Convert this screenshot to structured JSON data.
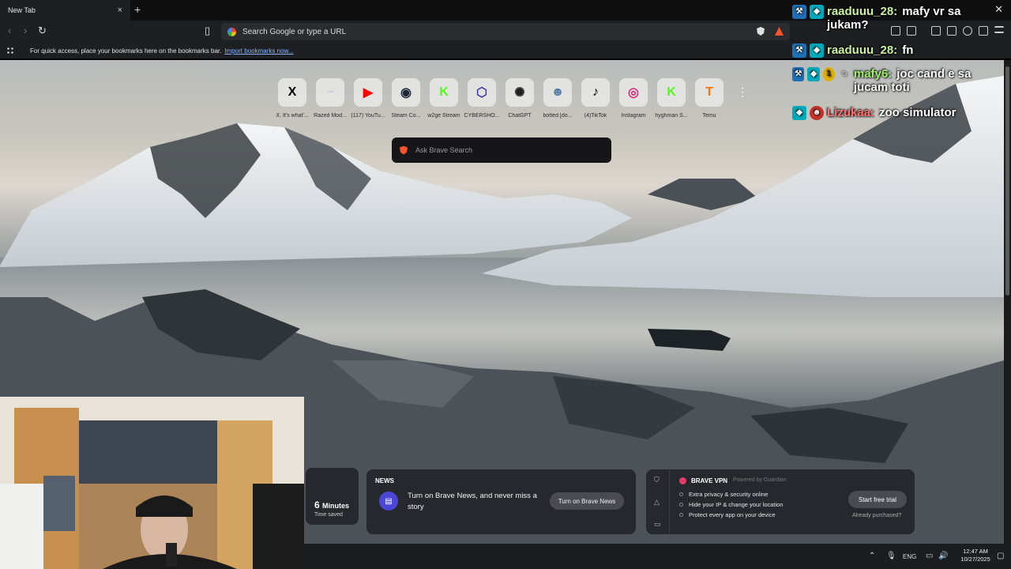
{
  "browser": {
    "tab_title": "New Tab",
    "tab_close": "×",
    "new_tab": "+",
    "window_close": "✕",
    "omnibox_placeholder": "Search Google or type a URL",
    "bookmarks_hint": "For quick access, place your bookmarks here on the bookmarks bar.",
    "import_link": "Import bookmarks now..."
  },
  "top_sites": [
    {
      "glyph": "X",
      "label": "X. It's what'...",
      "color": "#000000"
    },
    {
      "glyph": "~",
      "label": "Razed Mod...",
      "color": "#c9c9d6"
    },
    {
      "glyph": "▶",
      "label": "(117) YouTu...",
      "color": "#ff0000"
    },
    {
      "glyph": "◉",
      "label": "Steam Co...",
      "color": "#1b2838"
    },
    {
      "glyph": "K",
      "label": "w2ge Stream",
      "color": "#53fc18"
    },
    {
      "glyph": "⬡",
      "label": "CYBERSHO...",
      "color": "#3c3ca8"
    },
    {
      "glyph": "✺",
      "label": "ChatGPT",
      "color": "#202020"
    },
    {
      "glyph": "☻",
      "label": "botted [do...",
      "color": "#5b7fa8"
    },
    {
      "glyph": "♪",
      "label": "(4)TikTok",
      "color": "#000000"
    },
    {
      "glyph": "◎",
      "label": "Instagram",
      "color": "#d62976"
    },
    {
      "glyph": "K",
      "label": "hyghman S...",
      "color": "#53fc18"
    },
    {
      "glyph": "T",
      "label": "Temu",
      "color": "#fb7701"
    }
  ],
  "search": {
    "placeholder": "Ask Brave Search"
  },
  "stats": {
    "minutes_value": "6",
    "minutes_unit": "Minutes",
    "saved_label": "Time saved"
  },
  "news": {
    "title": "NEWS",
    "text": "Turn on Brave News, and never miss a story",
    "button": "Turn on Brave News"
  },
  "vpn": {
    "title": "BRAVE VPN",
    "powered": "Powered by Guardian",
    "features": [
      "Extra privacy & security online",
      "Hide your IP & change your location",
      "Protect every app on your device"
    ],
    "button": "Start free trial",
    "purchased": "Already purchased?"
  },
  "taskbar": {
    "language": "ENG",
    "time": "12:47 AM",
    "date": "10/27/2025"
  },
  "chat": [
    {
      "user": "raaduuu_28:",
      "message": "mafy vr sa jukam?",
      "user_color": "#c9f29c"
    },
    {
      "user": "raaduuu_28:",
      "message": "fn",
      "user_color": "#c9f29c"
    },
    {
      "user": "mafy6:",
      "message": "joc cand e sa jucam toti",
      "user_color": "#9ef06a"
    },
    {
      "user": "Lizukaa:",
      "message": "zoo simulator",
      "user_color": "#ff7070"
    }
  ],
  "colors": {
    "brave_orange": "#fb542b",
    "news_purple": "#4b47d6",
    "vpn_pink": "#e33c6e"
  }
}
